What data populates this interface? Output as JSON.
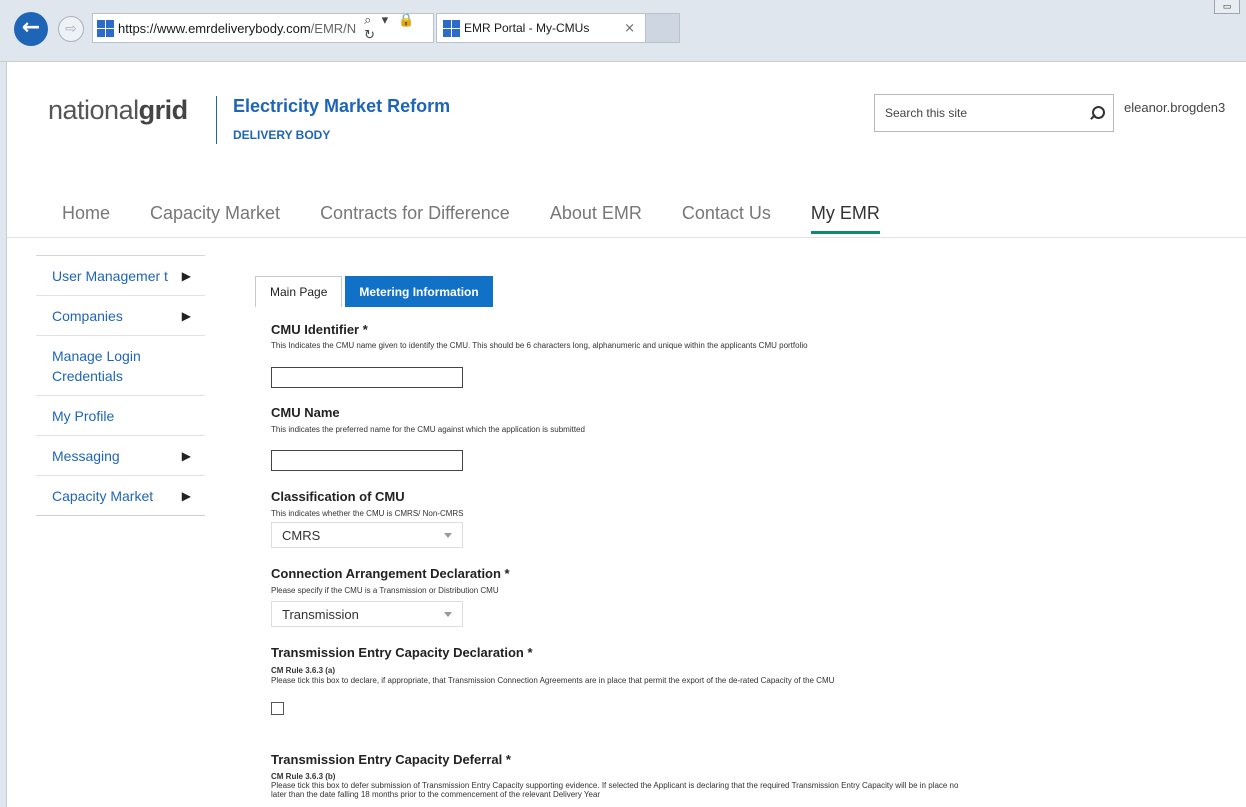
{
  "browser": {
    "url_host": "https://www.emrdeliverybody.com",
    "url_rest": "/EMR/N",
    "address_icons": "⌕ ▾ 🔒 ↻",
    "tab_title": "EMR Portal - My-CMUs",
    "tab_close": "×",
    "back_glyph": "←",
    "forward_glyph": "⇨",
    "window_button": "▭"
  },
  "header": {
    "logo_light": "national",
    "logo_bold": "grid",
    "brand_title": "Electricity Market Reform",
    "brand_sub": "DELIVERY BODY",
    "search_placeholder": "Search this site",
    "user": "eleanor.brogden3"
  },
  "nav": {
    "items": [
      "Home",
      "Capacity Market",
      "Contracts for Difference",
      "About EMR",
      "Contact Us",
      "My EMR"
    ],
    "active": "My EMR"
  },
  "sidebar": {
    "items": [
      {
        "label": "User Managemer t",
        "arrow": "▶"
      },
      {
        "label": "Companies",
        "arrow": "▶"
      },
      {
        "label": "Manage Login Credentials",
        "arrow": ""
      },
      {
        "label": "My Profile",
        "arrow": ""
      },
      {
        "label": "Messaging",
        "arrow": "▶"
      },
      {
        "label": "Capacity Market",
        "arrow": "▶"
      }
    ]
  },
  "tabs": {
    "main": "Main Page",
    "metering": "Metering Information"
  },
  "form": {
    "cmu_identifier": {
      "label": "CMU Identifier *",
      "help": "This Indicates the CMU name given to identify the CMU. This should be 6 characters long, alphanumeric and unique within the applicants CMU portfolio",
      "value": ""
    },
    "cmu_name": {
      "label": "CMU Name",
      "help": "This indicates the preferred name for the CMU against which the application is submitted",
      "value": ""
    },
    "classification": {
      "label": "Classification of CMU",
      "help": "This indicates whether the CMU is CMRS/ Non-CMRS",
      "value": "CMRS"
    },
    "connection": {
      "label": "Connection Arrangement Declaration *",
      "help": "Please specify if the CMU is a Transmission or Distribution CMU",
      "value": "Transmission"
    },
    "tec_declaration": {
      "label": "Transmission Entry Capacity Declaration *",
      "rule": "CM Rule 3.6.3 (a)",
      "help": "Please tick this box to declare, if appropriate, that Transmission Connection Agreements are in place that permit the export of the de-rated Capacity of the CMU",
      "checked": false
    },
    "tec_deferral": {
      "label": "Transmission Entry Capacity Deferral *",
      "rule": "CM Rule 3.6.3 (b)",
      "help_line1": "Please tick this box to defer submission of Transmission Entry Capacity supporting evidence. If selected the Applicant is declaring that the required Transmission Entry Capacity will be in place no",
      "help_line2": "later than the date falling 18 months prior to the commencement of the relevant Delivery Year"
    }
  }
}
